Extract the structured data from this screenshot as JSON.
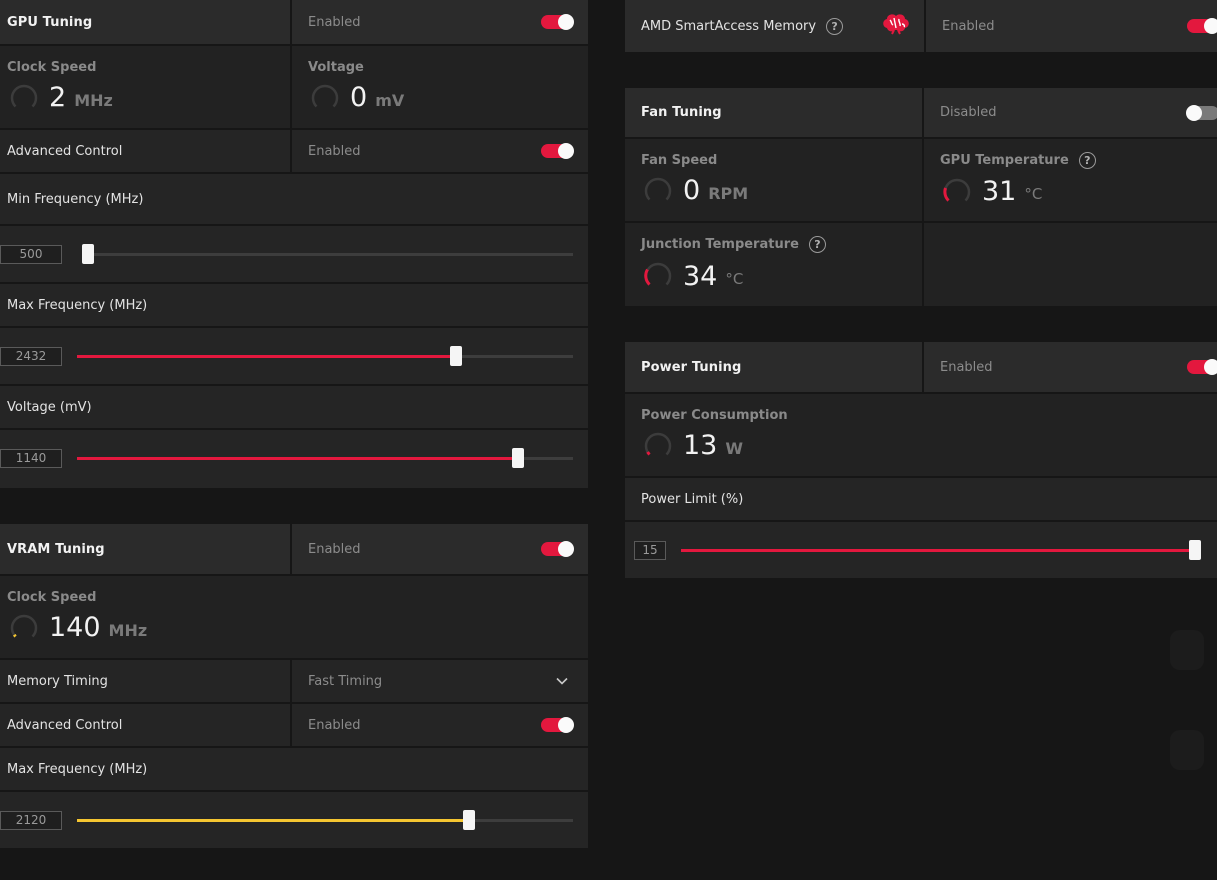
{
  "colors": {
    "accent": "#e3183e",
    "vram_accent": "#f5c631",
    "panel": "#252525",
    "background": "#161616"
  },
  "gpu_tuning": {
    "title": "GPU Tuning",
    "status": "Enabled",
    "enabled": true,
    "clock_speed": {
      "label": "Clock Speed",
      "value": "2",
      "unit": "MHz"
    },
    "voltage": {
      "label": "Voltage",
      "value": "0",
      "unit": "mV"
    },
    "advanced_control": {
      "label": "Advanced Control",
      "status": "Enabled",
      "enabled": true
    },
    "min_frequency": {
      "label": "Min Frequency (MHz)",
      "value": "500",
      "fill_fraction": 0.0
    },
    "max_frequency": {
      "label": "Max Frequency (MHz)",
      "value": "2432",
      "fill_fraction": 0.765
    },
    "voltage_mv": {
      "label": "Voltage (mV)",
      "value": "1140",
      "fill_fraction": 0.89
    }
  },
  "vram_tuning": {
    "title": "VRAM Tuning",
    "status": "Enabled",
    "enabled": true,
    "clock_speed": {
      "label": "Clock Speed",
      "value": "140",
      "unit": "MHz"
    },
    "memory_timing": {
      "label": "Memory Timing",
      "selected": "Fast Timing",
      "icon": "chevron-down-icon"
    },
    "advanced_control": {
      "label": "Advanced Control",
      "status": "Enabled",
      "enabled": true
    },
    "max_frequency": {
      "label": "Max Frequency (MHz)",
      "value": "2120",
      "fill_fraction": 0.79
    }
  },
  "smart_access_memory": {
    "label": "AMD SmartAccess Memory",
    "status": "Enabled",
    "enabled": true,
    "icon": "brain-icon"
  },
  "fan_tuning": {
    "title": "Fan Tuning",
    "status": "Disabled",
    "enabled": false,
    "fan_speed": {
      "label": "Fan Speed",
      "value": "0",
      "unit": "RPM"
    },
    "gpu_temperature": {
      "label": "GPU Temperature",
      "value": "31",
      "unit": "°C"
    },
    "junction_temperature": {
      "label": "Junction Temperature",
      "value": "34",
      "unit": "°C"
    }
  },
  "power_tuning": {
    "title": "Power Tuning",
    "status": "Enabled",
    "enabled": true,
    "power_consumption": {
      "label": "Power Consumption",
      "value": "13",
      "unit": "W"
    },
    "power_limit": {
      "label": "Power Limit (%)",
      "value": "15",
      "fill_fraction": 1.0
    }
  }
}
